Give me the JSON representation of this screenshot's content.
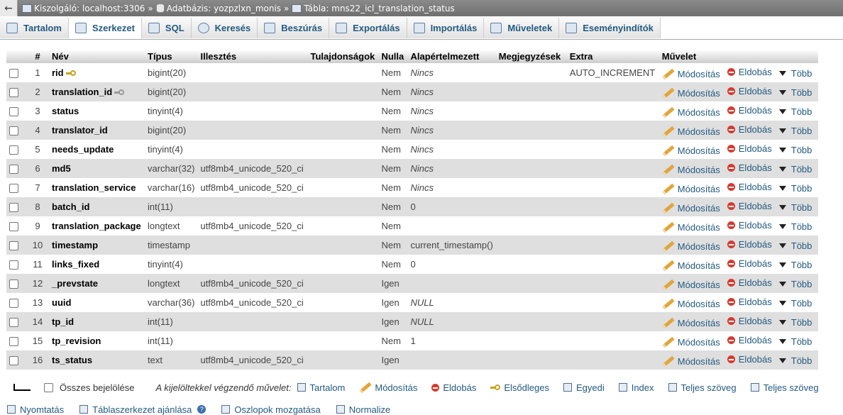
{
  "breadcrumb": {
    "back": "←",
    "server": "Kiszolgáló: localhost:3306",
    "database": "Adatbázis: yozpzlxn_monis",
    "table": "Tábla: mns22_icl_translation_status",
    "separator": "»"
  },
  "tabs": [
    {
      "label": "Tartalom",
      "icon": "browse-icon"
    },
    {
      "label": "Szerkezet",
      "icon": "structure-icon",
      "active": true
    },
    {
      "label": "SQL",
      "icon": "sql-icon"
    },
    {
      "label": "Keresés",
      "icon": "search-icon"
    },
    {
      "label": "Beszúrás",
      "icon": "insert-icon"
    },
    {
      "label": "Exportálás",
      "icon": "export-icon"
    },
    {
      "label": "Importálás",
      "icon": "import-icon"
    },
    {
      "label": "Műveletek",
      "icon": "wrench-icon"
    },
    {
      "label": "Eseményindítók",
      "icon": "triggers-icon"
    }
  ],
  "table": {
    "headers": {
      "num": "#",
      "name": "Név",
      "type": "Típus",
      "collation": "Illesztés",
      "attributes": "Tulajdonságok",
      "null": "Nulla",
      "default": "Alapértelmezett",
      "comments": "Megjegyzések",
      "extra": "Extra",
      "action": "Művelet"
    },
    "actions": {
      "change": "Módosítás",
      "drop": "Eldobás",
      "more": "Több"
    },
    "rows": [
      {
        "num": "1",
        "name": "rid",
        "key": "primary",
        "type": "bigint(20)",
        "collation": "",
        "null": "Nem",
        "default": "Nincs",
        "extra": "AUTO_INCREMENT"
      },
      {
        "num": "2",
        "name": "translation_id",
        "key": "index",
        "type": "bigint(20)",
        "collation": "",
        "null": "Nem",
        "default": "Nincs",
        "extra": ""
      },
      {
        "num": "3",
        "name": "status",
        "type": "tinyint(4)",
        "collation": "",
        "null": "Nem",
        "default": "Nincs",
        "extra": ""
      },
      {
        "num": "4",
        "name": "translator_id",
        "type": "bigint(20)",
        "collation": "",
        "null": "Nem",
        "default": "Nincs",
        "extra": ""
      },
      {
        "num": "5",
        "name": "needs_update",
        "type": "tinyint(4)",
        "collation": "",
        "null": "Nem",
        "default": "Nincs",
        "extra": ""
      },
      {
        "num": "6",
        "name": "md5",
        "type": "varchar(32)",
        "collation": "utf8mb4_unicode_520_ci",
        "null": "Nem",
        "default": "Nincs",
        "extra": ""
      },
      {
        "num": "7",
        "name": "translation_service",
        "type": "varchar(16)",
        "collation": "utf8mb4_unicode_520_ci",
        "null": "Nem",
        "default": "Nincs",
        "extra": ""
      },
      {
        "num": "8",
        "name": "batch_id",
        "type": "int(11)",
        "collation": "",
        "null": "Nem",
        "default": "0",
        "extra": ""
      },
      {
        "num": "9",
        "name": "translation_package",
        "type": "longtext",
        "collation": "utf8mb4_unicode_520_ci",
        "null": "Nem",
        "default": "",
        "extra": ""
      },
      {
        "num": "10",
        "name": "timestamp",
        "type": "timestamp",
        "collation": "",
        "null": "Nem",
        "default": "current_timestamp()",
        "extra": ""
      },
      {
        "num": "11",
        "name": "links_fixed",
        "type": "tinyint(4)",
        "collation": "",
        "null": "Nem",
        "default": "0",
        "extra": ""
      },
      {
        "num": "12",
        "name": "_prevstate",
        "type": "longtext",
        "collation": "utf8mb4_unicode_520_ci",
        "null": "Igen",
        "default": "",
        "extra": ""
      },
      {
        "num": "13",
        "name": "uuid",
        "type": "varchar(36)",
        "collation": "utf8mb4_unicode_520_ci",
        "null": "Igen",
        "default": "NULL",
        "extra": ""
      },
      {
        "num": "14",
        "name": "tp_id",
        "type": "int(11)",
        "collation": "",
        "null": "Igen",
        "default": "NULL",
        "extra": ""
      },
      {
        "num": "15",
        "name": "tp_revision",
        "type": "int(11)",
        "collation": "",
        "null": "Nem",
        "default": "1",
        "extra": ""
      },
      {
        "num": "16",
        "name": "ts_status",
        "type": "text",
        "collation": "utf8mb4_unicode_520_ci",
        "null": "Igen",
        "default": "",
        "extra": ""
      }
    ]
  },
  "bulk": {
    "check_all": "Összes bejelölése",
    "with_selected": "A kijelöltekkel végzendő művelet:",
    "actions": [
      "Tartalom",
      "Módosítás",
      "Eldobás",
      "Elsődleges",
      "Egyedi",
      "Index",
      "Teljes szöveg",
      "Teljes szöveg"
    ]
  },
  "footer": {
    "print": "Nyomtatás",
    "propose": "Táblaszerkezet ajánlása",
    "move_columns": "Oszlopok mozgatása",
    "normalize": "Normalize"
  }
}
